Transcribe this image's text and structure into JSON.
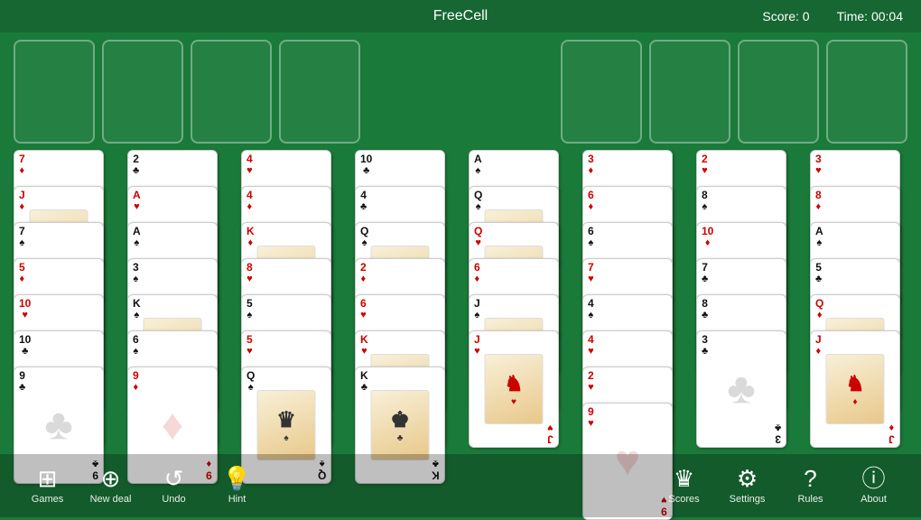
{
  "header": {
    "title": "FreeCell",
    "score_label": "Score:",
    "score_value": "0",
    "time_label": "Time:",
    "time_value": "00:04"
  },
  "toolbar": {
    "left_buttons": [
      {
        "id": "games",
        "label": "Games",
        "icon": "🎮"
      },
      {
        "id": "new-deal",
        "label": "New deal",
        "icon": "➕"
      },
      {
        "id": "undo",
        "label": "Undo",
        "icon": "↩"
      },
      {
        "id": "hint",
        "label": "Hint",
        "icon": "💡"
      }
    ],
    "right_buttons": [
      {
        "id": "scores",
        "label": "Scores",
        "icon": "👑"
      },
      {
        "id": "settings",
        "label": "Settings",
        "icon": "⚙"
      },
      {
        "id": "rules",
        "label": "Rules",
        "icon": "❓"
      },
      {
        "id": "about",
        "label": "About",
        "icon": "ℹ"
      }
    ]
  },
  "columns": [
    {
      "id": 1,
      "cards": [
        {
          "value": "7",
          "suit": "♦",
          "color": "red",
          "face": false
        },
        {
          "value": "J",
          "suit": "♦",
          "color": "red",
          "face": true
        },
        {
          "value": "7",
          "suit": "♠",
          "color": "black",
          "face": false
        },
        {
          "value": "5",
          "suit": "♦",
          "color": "red",
          "face": false
        },
        {
          "value": "10",
          "suit": "♥",
          "color": "red",
          "face": false
        },
        {
          "value": "10",
          "suit": "♣",
          "color": "black",
          "face": false
        },
        {
          "value": "9",
          "suit": "♣",
          "color": "black",
          "face": false
        }
      ]
    },
    {
      "id": 2,
      "cards": [
        {
          "value": "2",
          "suit": "♣",
          "color": "black",
          "face": false
        },
        {
          "value": "A",
          "suit": "♥",
          "color": "red",
          "face": false
        },
        {
          "value": "A",
          "suit": "♠",
          "color": "black",
          "face": false
        },
        {
          "value": "3",
          "suit": "♠",
          "color": "black",
          "face": false
        },
        {
          "value": "K",
          "suit": "♠",
          "color": "black",
          "face": true
        },
        {
          "value": "6",
          "suit": "♠",
          "color": "black",
          "face": false
        },
        {
          "value": "9",
          "suit": "♦",
          "color": "red",
          "face": false
        }
      ]
    },
    {
      "id": 3,
      "cards": [
        {
          "value": "4",
          "suit": "♥",
          "color": "red",
          "face": false
        },
        {
          "value": "4",
          "suit": "♦",
          "color": "red",
          "face": false
        },
        {
          "value": "K",
          "suit": "♦",
          "color": "red",
          "face": true
        },
        {
          "value": "8",
          "suit": "♥",
          "color": "red",
          "face": false
        },
        {
          "value": "5",
          "suit": "♠",
          "color": "black",
          "face": false
        },
        {
          "value": "5",
          "suit": "♥",
          "color": "red",
          "face": false
        },
        {
          "value": "Q",
          "suit": "♠",
          "color": "black",
          "face": true
        }
      ]
    },
    {
      "id": 4,
      "cards": [
        {
          "value": "10",
          "suit": "♣",
          "color": "black",
          "face": false
        },
        {
          "value": "4",
          "suit": "♣",
          "color": "black",
          "face": false
        },
        {
          "value": "Q",
          "suit": "♠",
          "color": "black",
          "face": true
        },
        {
          "value": "2",
          "suit": "♦",
          "color": "red",
          "face": false
        },
        {
          "value": "6",
          "suit": "♥",
          "color": "red",
          "face": false
        },
        {
          "value": "K",
          "suit": "♥",
          "color": "red",
          "face": true
        },
        {
          "value": "K",
          "suit": "♣",
          "color": "black",
          "face": true
        }
      ]
    },
    {
      "id": 5,
      "cards": [
        {
          "value": "A",
          "suit": "♠",
          "color": "black",
          "face": false
        },
        {
          "value": "Q",
          "suit": "♠",
          "color": "black",
          "face": true
        },
        {
          "value": "Q",
          "suit": "♥",
          "color": "red",
          "face": true
        },
        {
          "value": "6",
          "suit": "♦",
          "color": "red",
          "face": false
        },
        {
          "value": "J",
          "suit": "♠",
          "color": "black",
          "face": true
        },
        {
          "value": "J",
          "suit": "♥",
          "color": "red",
          "face": true
        }
      ]
    },
    {
      "id": 6,
      "cards": [
        {
          "value": "3",
          "suit": "♦",
          "color": "red",
          "face": false
        },
        {
          "value": "6",
          "suit": "♦",
          "color": "red",
          "face": false
        },
        {
          "value": "6",
          "suit": "♠",
          "color": "black",
          "face": false
        },
        {
          "value": "7",
          "suit": "♥",
          "color": "red",
          "face": false
        },
        {
          "value": "4",
          "suit": "♠",
          "color": "black",
          "face": false
        },
        {
          "value": "4",
          "suit": "♥",
          "color": "red",
          "face": false
        },
        {
          "value": "2",
          "suit": "♥",
          "color": "red",
          "face": false
        },
        {
          "value": "9",
          "suit": "♥",
          "color": "red",
          "face": false
        }
      ]
    },
    {
      "id": 7,
      "cards": [
        {
          "value": "2",
          "suit": "♥",
          "color": "red",
          "face": false
        },
        {
          "value": "8",
          "suit": "♠",
          "color": "black",
          "face": false
        },
        {
          "value": "10",
          "suit": "♦",
          "color": "red",
          "face": false
        },
        {
          "value": "7",
          "suit": "♣",
          "color": "black",
          "face": false
        },
        {
          "value": "8",
          "suit": "♣",
          "color": "black",
          "face": false
        },
        {
          "value": "3",
          "suit": "♣",
          "color": "black",
          "face": false
        }
      ]
    },
    {
      "id": 8,
      "cards": [
        {
          "value": "3",
          "suit": "♥",
          "color": "red",
          "face": false
        },
        {
          "value": "8",
          "suit": "♦",
          "color": "red",
          "face": false
        },
        {
          "value": "A",
          "suit": "♠",
          "color": "black",
          "face": false
        },
        {
          "value": "5",
          "suit": "♣",
          "color": "black",
          "face": false
        },
        {
          "value": "Q",
          "suit": "♦",
          "color": "red",
          "face": true
        },
        {
          "value": "J",
          "suit": "♦",
          "color": "red",
          "face": true
        }
      ]
    }
  ]
}
